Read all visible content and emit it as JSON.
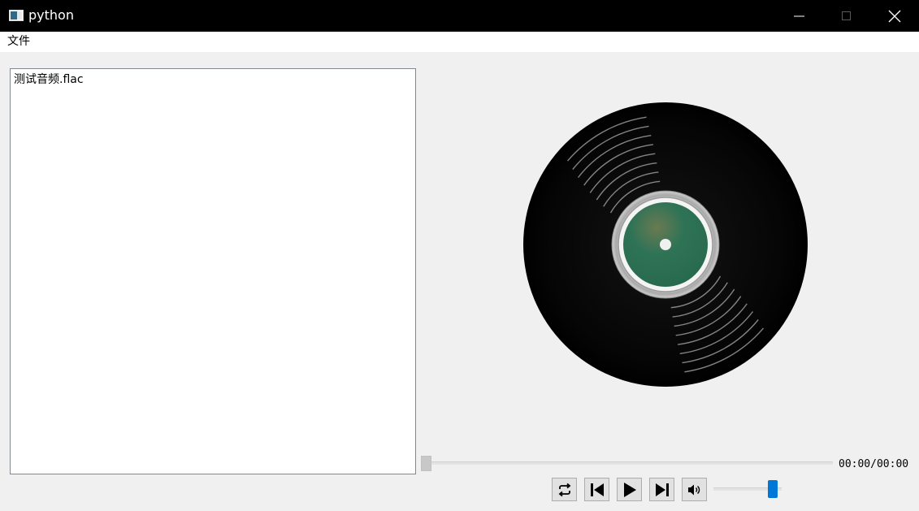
{
  "window": {
    "title": "python"
  },
  "menu": {
    "items": [
      "文件"
    ]
  },
  "playlist": {
    "items": [
      "测试音频.flac"
    ]
  },
  "player": {
    "time": "00:00/00:00",
    "progress": 0,
    "volume": 0.93,
    "label_color": "#2f7356",
    "accent": "#0078d7"
  },
  "controls": {
    "icons": [
      "loop-icon",
      "previous-icon",
      "play-icon",
      "next-icon",
      "volume-icon"
    ]
  }
}
